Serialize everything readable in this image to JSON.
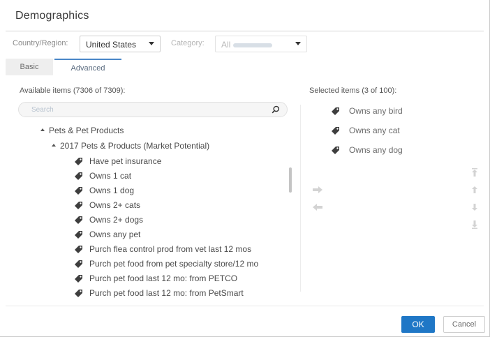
{
  "dialog": {
    "title": "Demographics"
  },
  "filters": {
    "country_label": "Country/Region:",
    "country_value": "United States",
    "category_label": "Category:",
    "category_value": "All"
  },
  "tabs": [
    {
      "label": "Basic",
      "active": false
    },
    {
      "label": "Advanced",
      "active": true
    }
  ],
  "available": {
    "heading": "Available items (7306 of 7309):",
    "search_placeholder": "Search",
    "tree": {
      "root": "Pets & Pet Products",
      "child": "2017 Pets & Products (Market Potential)",
      "items": [
        "Have pet insurance",
        "Owns 1 cat",
        "Owns 1 dog",
        "Owns 2+ cats",
        "Owns 2+ dogs",
        "Owns any pet",
        "Purch flea control prod from vet last 12 mos",
        "Purch pet food from pet specialty store/12 mo",
        "Purch pet food last 12 mo: from PETCO",
        "Purch pet food last 12 mo: from PetSmart"
      ]
    }
  },
  "selected": {
    "heading": "Selected items (3 of 100):",
    "items": [
      "Owns any bird",
      "Owns any cat",
      "Owns any dog"
    ]
  },
  "footer": {
    "ok_label": "OK",
    "cancel_label": "Cancel"
  },
  "colors": {
    "primary": "#1f77c6",
    "tab_accent": "#4a86c8"
  }
}
